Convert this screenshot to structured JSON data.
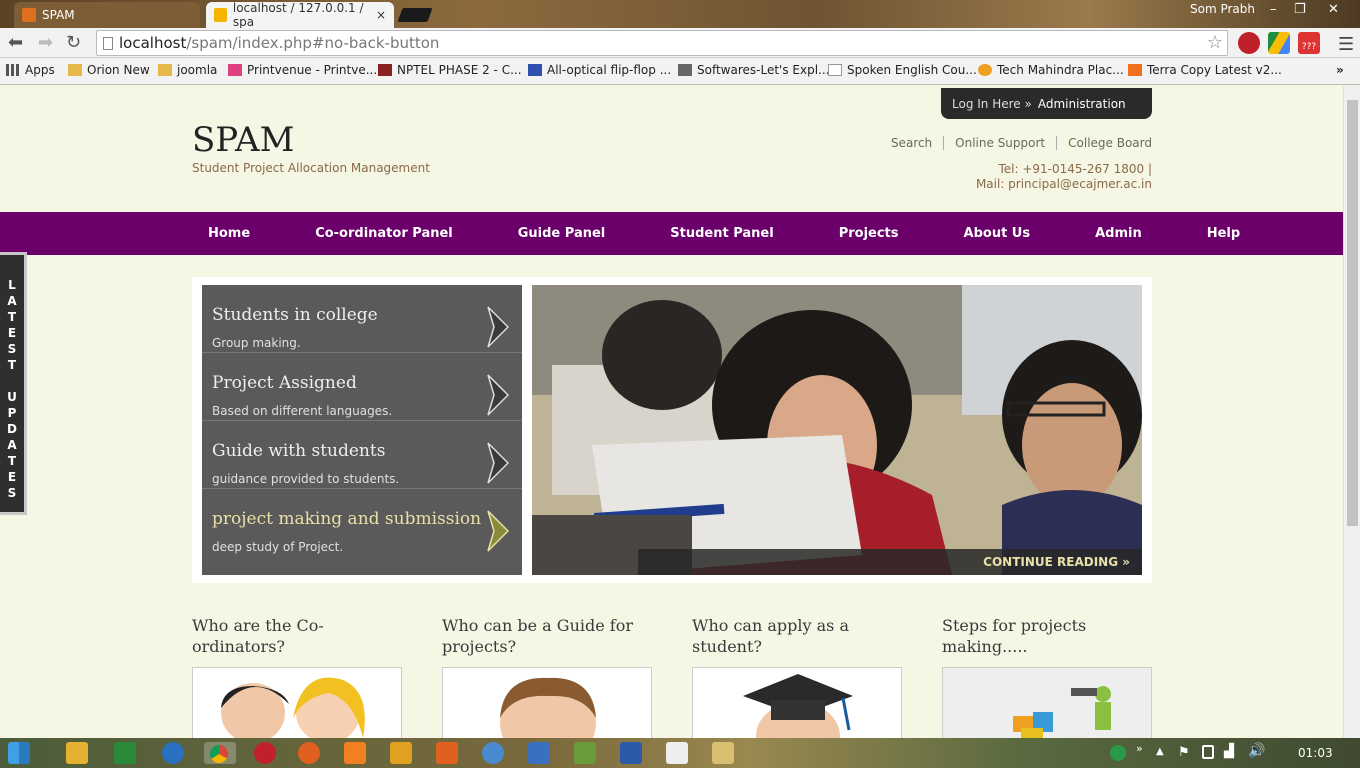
{
  "browser": {
    "tabs": [
      {
        "label": "SPAM"
      },
      {
        "label": "localhost / 127.0.0.1 / spa",
        "close": "×"
      }
    ],
    "window_user": "Som Prabh",
    "window_controls": [
      "–",
      "❐",
      "✕"
    ],
    "url_host": "localhost",
    "url_path": "/spam/index.php#no-back-button",
    "ext_badge": "???",
    "bookmarks": [
      "Apps",
      "Orion New",
      "joomla",
      "Printvenue - Printve...",
      "NPTEL PHASE 2 - C...",
      "All-optical flip-flop ...",
      "Softwares-Let's Expl...",
      "Spoken English Cou...",
      "Tech Mahindra Plac...",
      "Terra Copy Latest v2..."
    ],
    "bookmarks_more": "»"
  },
  "site": {
    "login": {
      "label": "Log In Here »",
      "admin": "Administration"
    },
    "logo": "SPAM",
    "tagline": "Student Project Allocation Management",
    "top_links": [
      "Search",
      "Online Support",
      "College Board"
    ],
    "tel": "Tel: +91-0145-267 1800 |",
    "mail": "Mail: principal@ecajmer.ac.in",
    "nav": [
      "Home",
      "Co-ordinator Panel",
      "Guide Panel",
      "Student Panel",
      "Projects",
      "About Us",
      "Admin",
      "Help"
    ],
    "latest_updates": "L A T E S T   U P D A T E S",
    "slides": [
      {
        "title": "Students in college",
        "sub": "Group making."
      },
      {
        "title": "Project Assigned",
        "sub": "Based on different languages."
      },
      {
        "title": "Guide with students",
        "sub": "guidance provided to students."
      },
      {
        "title": "project making and submission",
        "sub": "deep study of Project."
      }
    ],
    "continue": "CONTINUE READING »",
    "cards": [
      {
        "title": "Who are the Co-ordinators?"
      },
      {
        "title": "Who can be a Guide for projects?"
      },
      {
        "title": "Who can apply as a student?"
      },
      {
        "title": "Steps for projects making....."
      }
    ]
  },
  "taskbar": {
    "clock": "01:03"
  }
}
